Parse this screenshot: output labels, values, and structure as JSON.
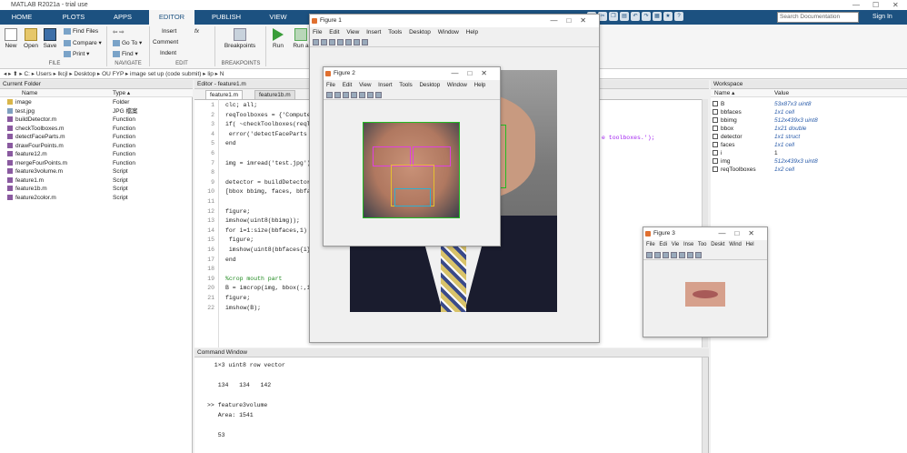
{
  "app": {
    "title": "MATLAB R2021a - trial use",
    "window_controls": [
      "—",
      "☐",
      "✕"
    ]
  },
  "main_tabs": [
    "HOME",
    "PLOTS",
    "APPS",
    "EDITOR",
    "PUBLISH",
    "VIEW"
  ],
  "search": {
    "placeholder": "Search Documentation"
  },
  "signin": "Sign In",
  "ribbon": {
    "new": "New",
    "open": "Open",
    "save": "Save",
    "find_files": "Find Files",
    "compare": "Compare ▾",
    "print": "Print ▾",
    "go_to": "Go To ▾",
    "find": "Find ▾",
    "insert": "Insert",
    "comment": "Comment",
    "indent": "Indent",
    "fx": "fx",
    "breakpoints": "Breakpoints",
    "run": "Run",
    "run_and": "Run a",
    "groups": [
      "FILE",
      "NAVIGATE",
      "EDIT",
      "BREAKPOINTS"
    ]
  },
  "address": "◂ ▸ ⬆ ▸ C: ▸ Users ▸ lkcjl ▸ Desktop ▸ OU FYP ▸ image set up (code submit) ▸ lip ▸ N",
  "current_folder": {
    "title": "Current Folder",
    "col_name": "Name",
    "col_type": "Type ▴",
    "files": [
      {
        "name": "image",
        "type": "Folder",
        "kind": "folder"
      },
      {
        "name": "test.jpg",
        "type": "JPG 檔案",
        "kind": "jpg"
      },
      {
        "name": "buildDetector.m",
        "type": "Function",
        "kind": "m"
      },
      {
        "name": "checkToolboxes.m",
        "type": "Function",
        "kind": "m"
      },
      {
        "name": "detectFaceParts.m",
        "type": "Function",
        "kind": "m"
      },
      {
        "name": "drawFourPoints.m",
        "type": "Function",
        "kind": "m"
      },
      {
        "name": "feature12.m",
        "type": "Function",
        "kind": "m"
      },
      {
        "name": "mergeFourPoints.m",
        "type": "Function",
        "kind": "m"
      },
      {
        "name": "feature3volume.m",
        "type": "Script",
        "kind": "m"
      },
      {
        "name": "feature1.m",
        "type": "Script",
        "kind": "m"
      },
      {
        "name": "feature1b.m",
        "type": "Script",
        "kind": "m"
      },
      {
        "name": "feature2color.m",
        "type": "Script",
        "kind": "m"
      }
    ]
  },
  "editor": {
    "title": "Editor - feature1.m",
    "tabs": [
      "feature1.m",
      "feature1b.m"
    ],
    "lines": [
      {
        "n": "1",
        "t": "clc; all;"
      },
      {
        "n": "2",
        "t": "reqToolboxes = {'Compute"
      },
      {
        "n": "3",
        "t": "if( ~checkToolboxes(reqTo"
      },
      {
        "n": "4",
        "t": " error('detectFaceParts r"
      },
      {
        "n": "5",
        "t": "end"
      },
      {
        "n": "6",
        "t": ""
      },
      {
        "n": "7",
        "t": "img = imread('test.jpg');"
      },
      {
        "n": "8",
        "t": ""
      },
      {
        "n": "9",
        "t": "detector = buildDetector("
      },
      {
        "n": "10",
        "t": "[bbox bbimg, faces, bbfac"
      },
      {
        "n": "11",
        "t": ""
      },
      {
        "n": "12",
        "t": "figure;"
      },
      {
        "n": "13",
        "t": "imshow(uint8(bbimg));"
      },
      {
        "n": "14",
        "t": "for i=1:size(bbfaces,1)"
      },
      {
        "n": "15",
        "t": " figure;"
      },
      {
        "n": "16",
        "t": " imshow(uint8(bbfaces{i}"
      },
      {
        "n": "17",
        "t": "end"
      },
      {
        "n": "18",
        "t": ""
      },
      {
        "n": "19",
        "t": "%crop mouth part"
      },
      {
        "n": "20",
        "t": "B = imcrop(img, bbox(:,1"
      },
      {
        "n": "21",
        "t": "figure;"
      },
      {
        "n": "22",
        "t": "imshow(B);"
      }
    ],
    "overflow_text": "e toolboxes.');"
  },
  "command_window": {
    "title": "Command Window",
    "lines": [
      "  1×3 uint8 row vector",
      "",
      "   134   134   142",
      "",
      ">> feature3volume",
      "   Area: 1541",
      "",
      "   53"
    ]
  },
  "workspace": {
    "title": "Workspace",
    "col_name": "Name ▴",
    "col_value": "Value",
    "vars": [
      {
        "name": "B",
        "value": "53x87x3 uint8"
      },
      {
        "name": "bbfaces",
        "value": "1x1 cell"
      },
      {
        "name": "bbimg",
        "value": "512x439x3 uint8"
      },
      {
        "name": "bbox",
        "value": "1x21 double"
      },
      {
        "name": "detector",
        "value": "1x1 struct"
      },
      {
        "name": "faces",
        "value": "1x1 cell"
      },
      {
        "name": "i",
        "value": "1"
      },
      {
        "name": "img",
        "value": "512x439x3 uint8"
      },
      {
        "name": "reqToolboxes",
        "value": "1x2 cell"
      }
    ]
  },
  "figure1": {
    "title": "Figure 1",
    "menu": [
      "File",
      "Edit",
      "View",
      "Insert",
      "Tools",
      "Desktop",
      "Window",
      "Help"
    ]
  },
  "figure2": {
    "title": "Figure 2",
    "menu": [
      "File",
      "Edit",
      "View",
      "Insert",
      "Tools",
      "Desktop",
      "Window",
      "Help"
    ]
  },
  "figure3": {
    "title": "Figure 3",
    "menu": [
      "File",
      "Edi",
      "Vie",
      "Inse",
      "Too",
      "Deskt",
      "Wind",
      "Hel"
    ]
  }
}
